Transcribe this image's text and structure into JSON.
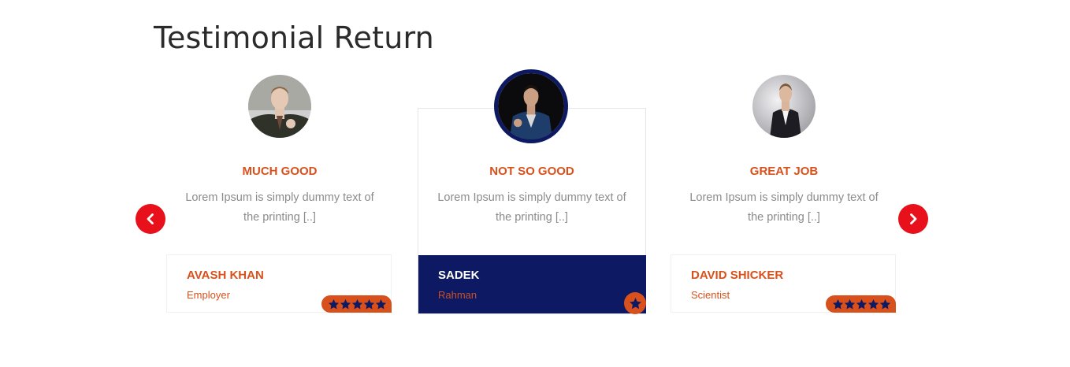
{
  "section": {
    "title": "Testimonial Return"
  },
  "colors": {
    "accent": "#d8501b",
    "navy": "#0d1a63",
    "arrow": "#e8101b",
    "muted": "#8b8b8b"
  },
  "navigation": {
    "prev_icon": "chevron-left-icon",
    "next_icon": "chevron-right-icon"
  },
  "testimonials": [
    {
      "heading": "MUCH GOOD",
      "text": "Lorem Ipsum is simply dummy text of the printing [..]",
      "name": "AVASH KHAN",
      "role": "Employer",
      "rating": 5,
      "active": false
    },
    {
      "heading": "NOT SO GOOD",
      "text": "Lorem Ipsum is simply dummy text of the printing [..]",
      "name": "SADEK",
      "role": "Rahman",
      "rating": 1,
      "active": true
    },
    {
      "heading": "GREAT JOB",
      "text": "Lorem Ipsum is simply dummy text of the printing [..]",
      "name": "DAVID SHICKER",
      "role": "Scientist",
      "rating": 5,
      "active": false
    }
  ]
}
